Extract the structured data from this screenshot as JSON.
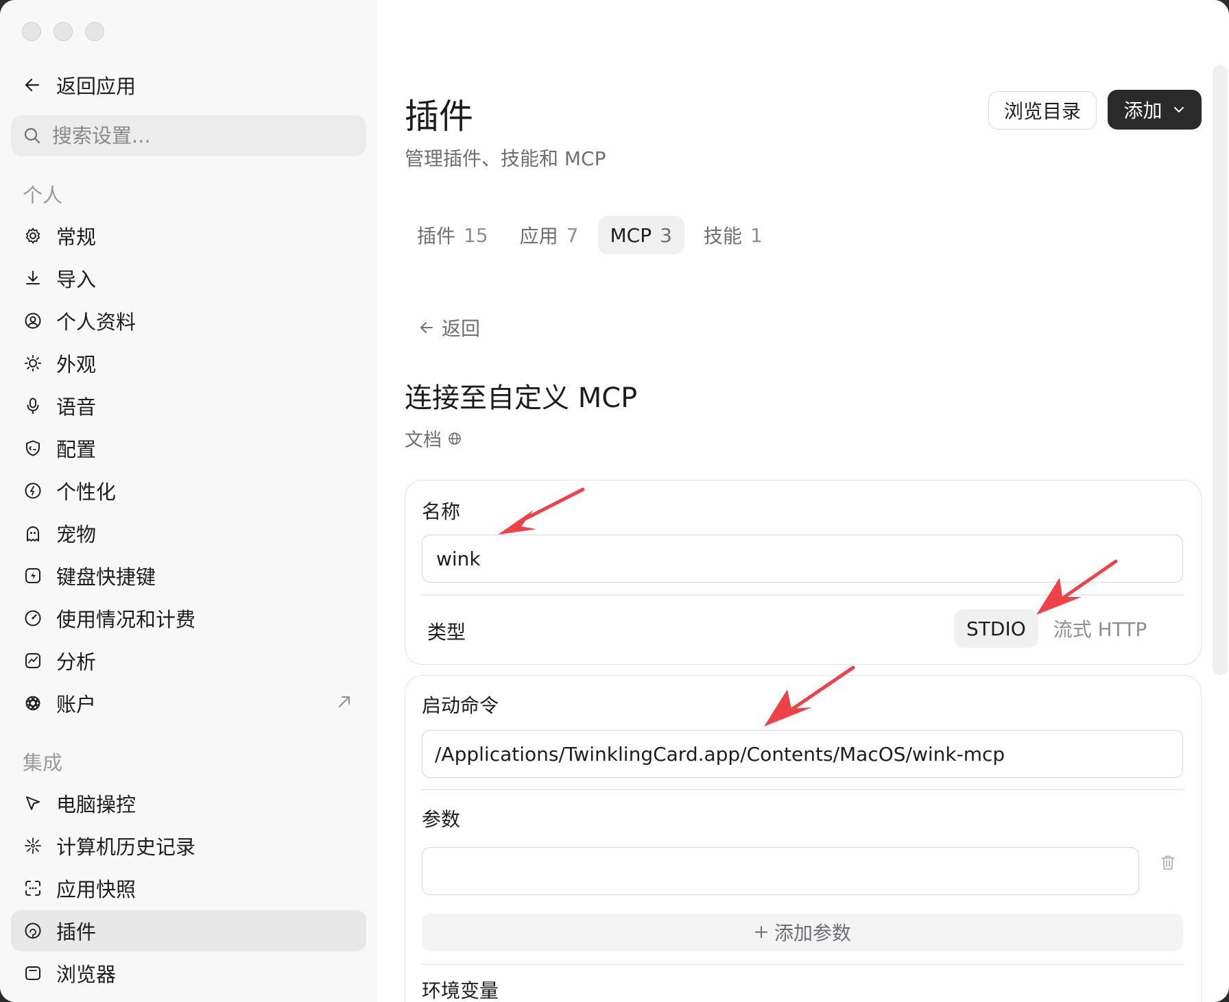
{
  "sidebar": {
    "back_label": "返回应用",
    "search_placeholder": "搜索设置...",
    "section_personal": "个人",
    "personal_items": [
      {
        "label": "常规",
        "icon": "gear-icon"
      },
      {
        "label": "导入",
        "icon": "download-icon"
      },
      {
        "label": "个人资料",
        "icon": "person-circle-icon"
      },
      {
        "label": "外观",
        "icon": "sun-icon"
      },
      {
        "label": "语音",
        "icon": "microphone-icon"
      },
      {
        "label": "配置",
        "icon": "shield-code-icon"
      },
      {
        "label": "个性化",
        "icon": "spark-circle-icon"
      },
      {
        "label": "宠物",
        "icon": "ghost-icon"
      },
      {
        "label": "键盘快捷键",
        "icon": "lightning-box-icon"
      },
      {
        "label": "使用情况和计费",
        "icon": "gauge-icon"
      },
      {
        "label": "分析",
        "icon": "chart-box-icon"
      },
      {
        "label": "账户",
        "icon": "openai-logo-icon"
      }
    ],
    "section_integrations": "集成",
    "integration_items": [
      {
        "label": "电脑操控",
        "icon": "cursor-icon"
      },
      {
        "label": "计算机历史记录",
        "icon": "burst-icon"
      },
      {
        "label": "应用快照",
        "icon": "screenshot-frame-icon"
      },
      {
        "label": "插件",
        "icon": "plugin-icon",
        "active": true
      },
      {
        "label": "浏览器",
        "icon": "browser-window-icon"
      }
    ]
  },
  "header": {
    "title": "插件",
    "subtitle": "管理插件、技能和 MCP",
    "browse_label": "浏览目录",
    "add_label": "添加"
  },
  "tabs": [
    {
      "label": "插件",
      "count": "15",
      "active": false
    },
    {
      "label": "应用",
      "count": "7",
      "active": false
    },
    {
      "label": "MCP",
      "count": "3",
      "active": true
    },
    {
      "label": "技能",
      "count": "1",
      "active": false
    }
  ],
  "detail": {
    "back_label": "返回",
    "heading": "连接至自定义 MCP",
    "docs_label": "文档",
    "name_label": "名称",
    "name_value": "wink",
    "type_label": "类型",
    "type_options": [
      "STDIO",
      "流式 HTTP"
    ],
    "type_selected": "STDIO",
    "command_label": "启动命令",
    "command_value": "/Applications/TwinklingCard.app/Contents/MacOS/wink-mcp",
    "args_label": "参数",
    "arg_value": "",
    "add_arg_label": "添加参数",
    "env_label": "环境变量"
  },
  "colors": {
    "accent_dark": "#2a2a2a",
    "annotation_arrow": "#ef4148",
    "active_bg": "#e8e8e8"
  }
}
